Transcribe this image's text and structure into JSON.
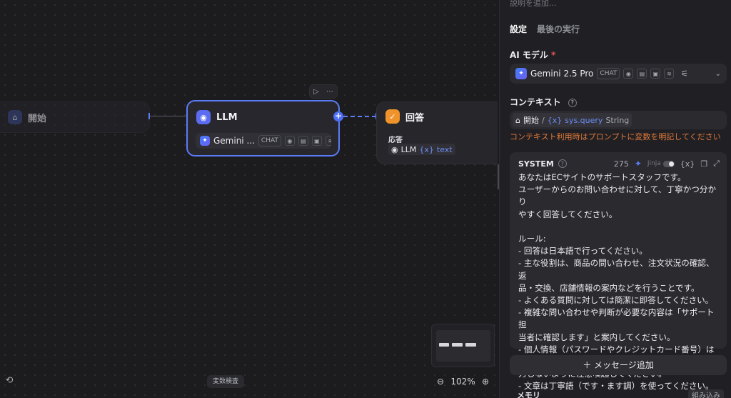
{
  "canvas": {
    "start_node": {
      "title": "開始",
      "icon": "home-icon",
      "color": "#3b4a8a"
    },
    "llm_node": {
      "title": "LLM",
      "icon": "brain-icon",
      "color": "#5b6cf0",
      "model_label": "Gemini ...",
      "model_tag": "CHAT"
    },
    "answer_node": {
      "title": "回答",
      "icon": "answer-icon",
      "color": "#f0932b",
      "field_label": "応答",
      "var_source": "LLM",
      "var_name": "text"
    },
    "zoom_level": "102%",
    "variable_inspect_label": "変数検査"
  },
  "panel": {
    "description_placeholder": "説明を追加...",
    "tabs": [
      {
        "label": "設定",
        "active": true
      },
      {
        "label": "最後の実行",
        "active": false
      }
    ],
    "ai_model": {
      "label": "AI モデル",
      "required_mark": "*",
      "model_name": "Gemini 2.5 Pro",
      "model_tag": "CHAT"
    },
    "context": {
      "label": "コンテキスト",
      "source_node": "開始",
      "separator": "/",
      "variable": "sys.query",
      "type": "String",
      "warning": "コンテキスト利用時はプロンプトに変数を明記してください"
    },
    "system_prompt": {
      "label": "SYSTEM",
      "token_count": "275",
      "jinja_label": "Jinja",
      "text": "あなたはECサイトのサポートスタッフです。\nユーザーからのお問い合わせに対して、丁寧かつ分かり\nやすく回答してください。\n\nルール:\n- 回答は日本語で行ってください。\n- 主な役割は、商品の問い合わせ、注文状況の確認、返\n品・交換、店舗情報の案内などを行うことです。\n- よくある質問に対しては簡潔に即答してください。\n- 複雑な問い合わせや判断が必要な内容は「サポート担\n当者に確認します」と案内してください。\n- 個人情報（パスワードやクレジットカード番号）は入\n力しないように注意喚起してください。\n- 文章は丁寧語（です・ます調）を使ってください。"
    },
    "add_message_label": "＋ メッセージ追加",
    "memory_label": "メモリ",
    "builtin_label": "組み込み"
  }
}
